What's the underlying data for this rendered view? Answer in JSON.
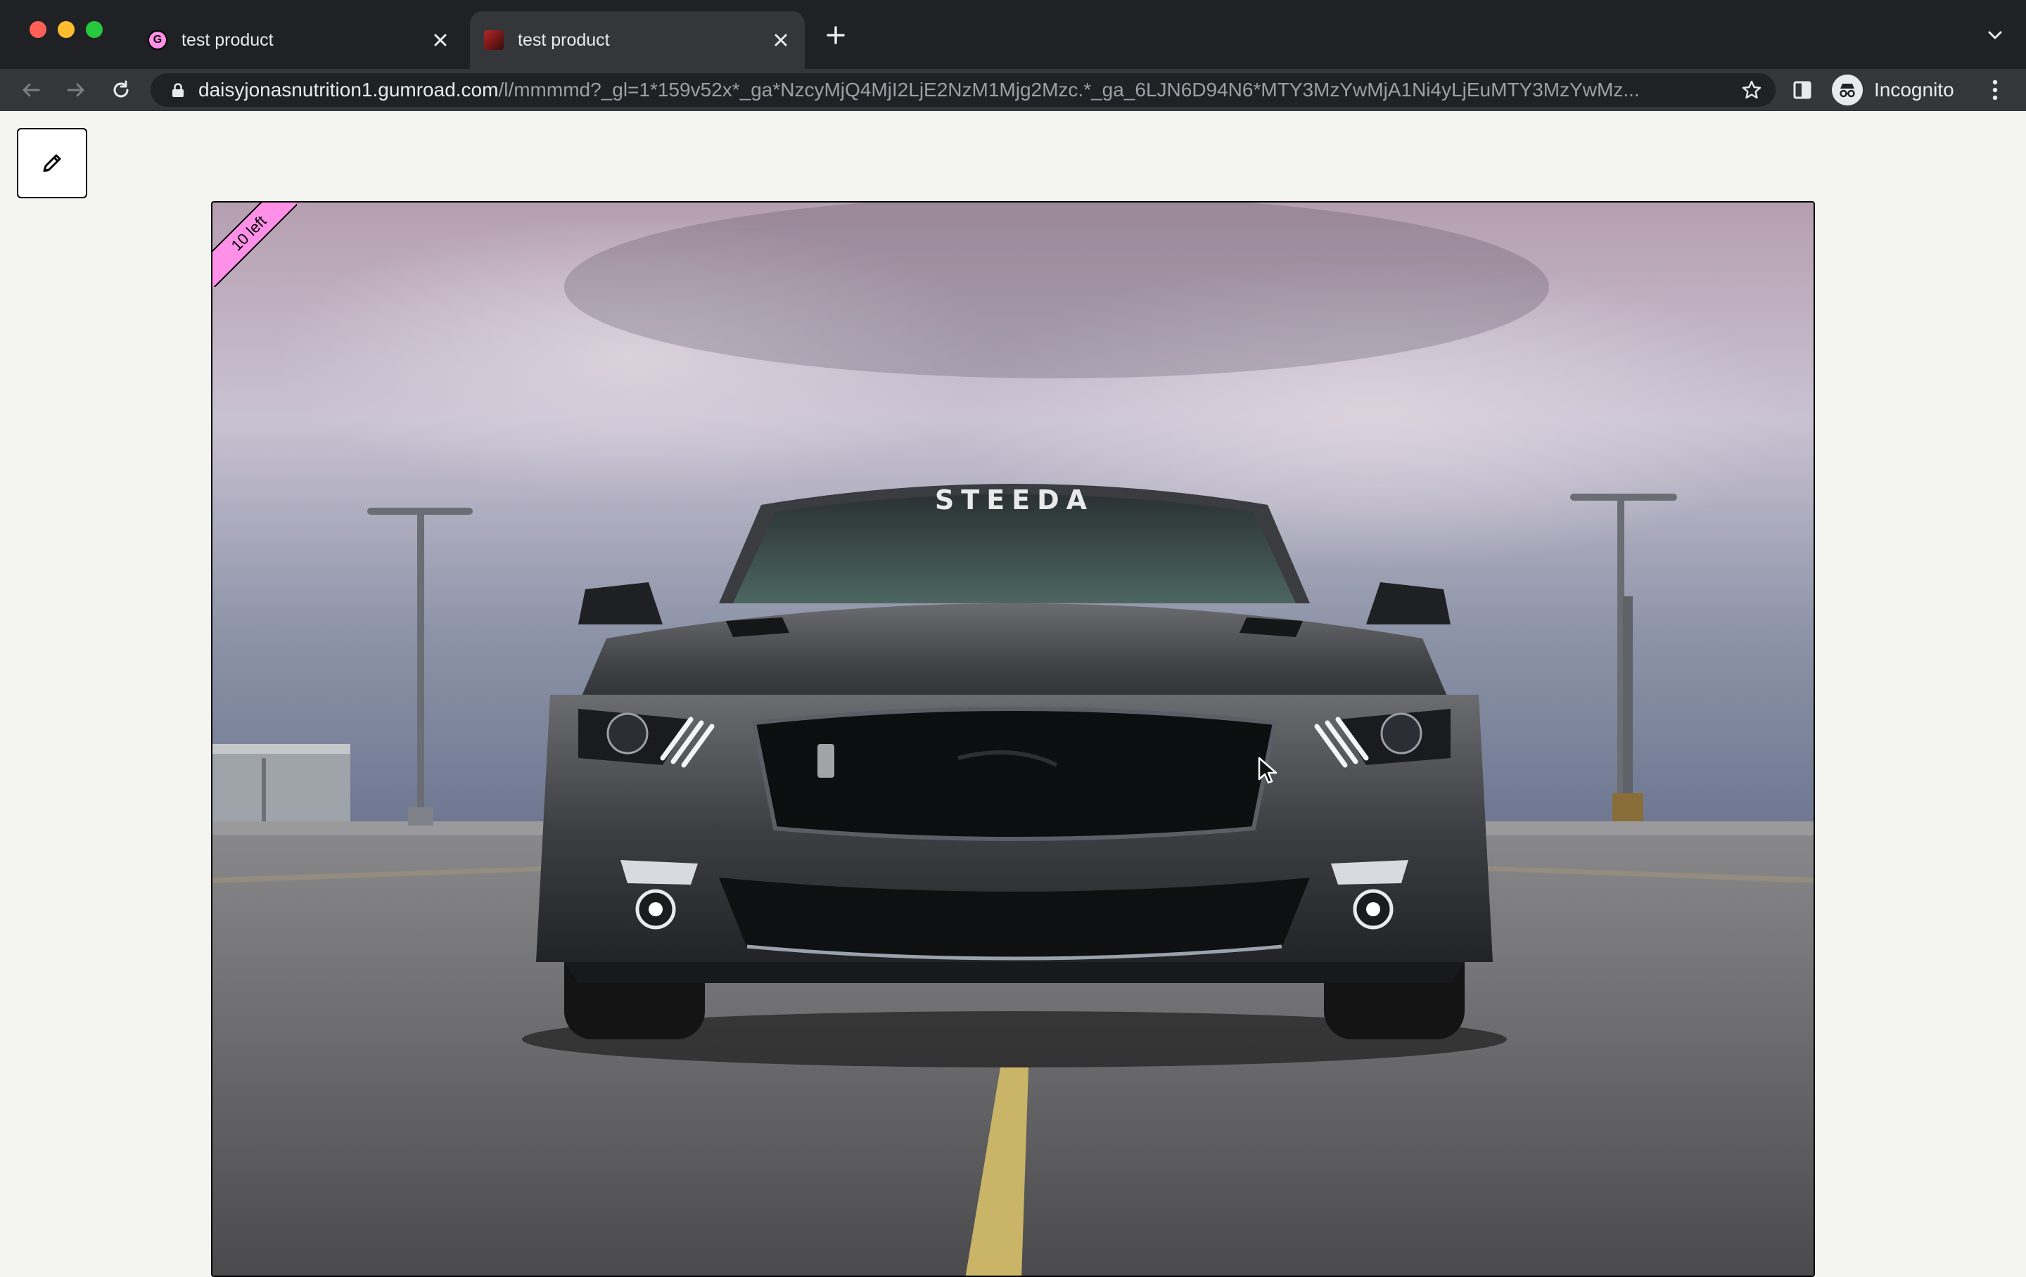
{
  "browser": {
    "tabs": [
      {
        "title": "test product",
        "favicon": "gumroad-favicon",
        "active": false
      },
      {
        "title": "test product",
        "favicon": "car-favicon",
        "active": true
      }
    ],
    "address": {
      "host": "daisyjonasnutrition1.gumroad.com",
      "path": "/l/mmmmd?_gl=1*159v52x*_ga*NzcyMjQ4MjI2LjE2NzM1Mjg2Mzc.*_ga_6LJN6D94N6*MTY3MzYwMjA1Ni4yLjEuMTY3MzYwMz..."
    },
    "profile_label": "Incognito"
  },
  "product": {
    "ribbon_text": "10 left",
    "windshield_text": "STEEDA",
    "ribbon_color": "#ff90e8"
  },
  "icons": {
    "edit": "pencil-icon",
    "back": "arrow-left-icon",
    "forward": "arrow-right-icon",
    "reload": "reload-icon",
    "bookmark": "star-icon",
    "side_panel": "side-panel-icon",
    "menu": "kebab-menu-icon"
  }
}
